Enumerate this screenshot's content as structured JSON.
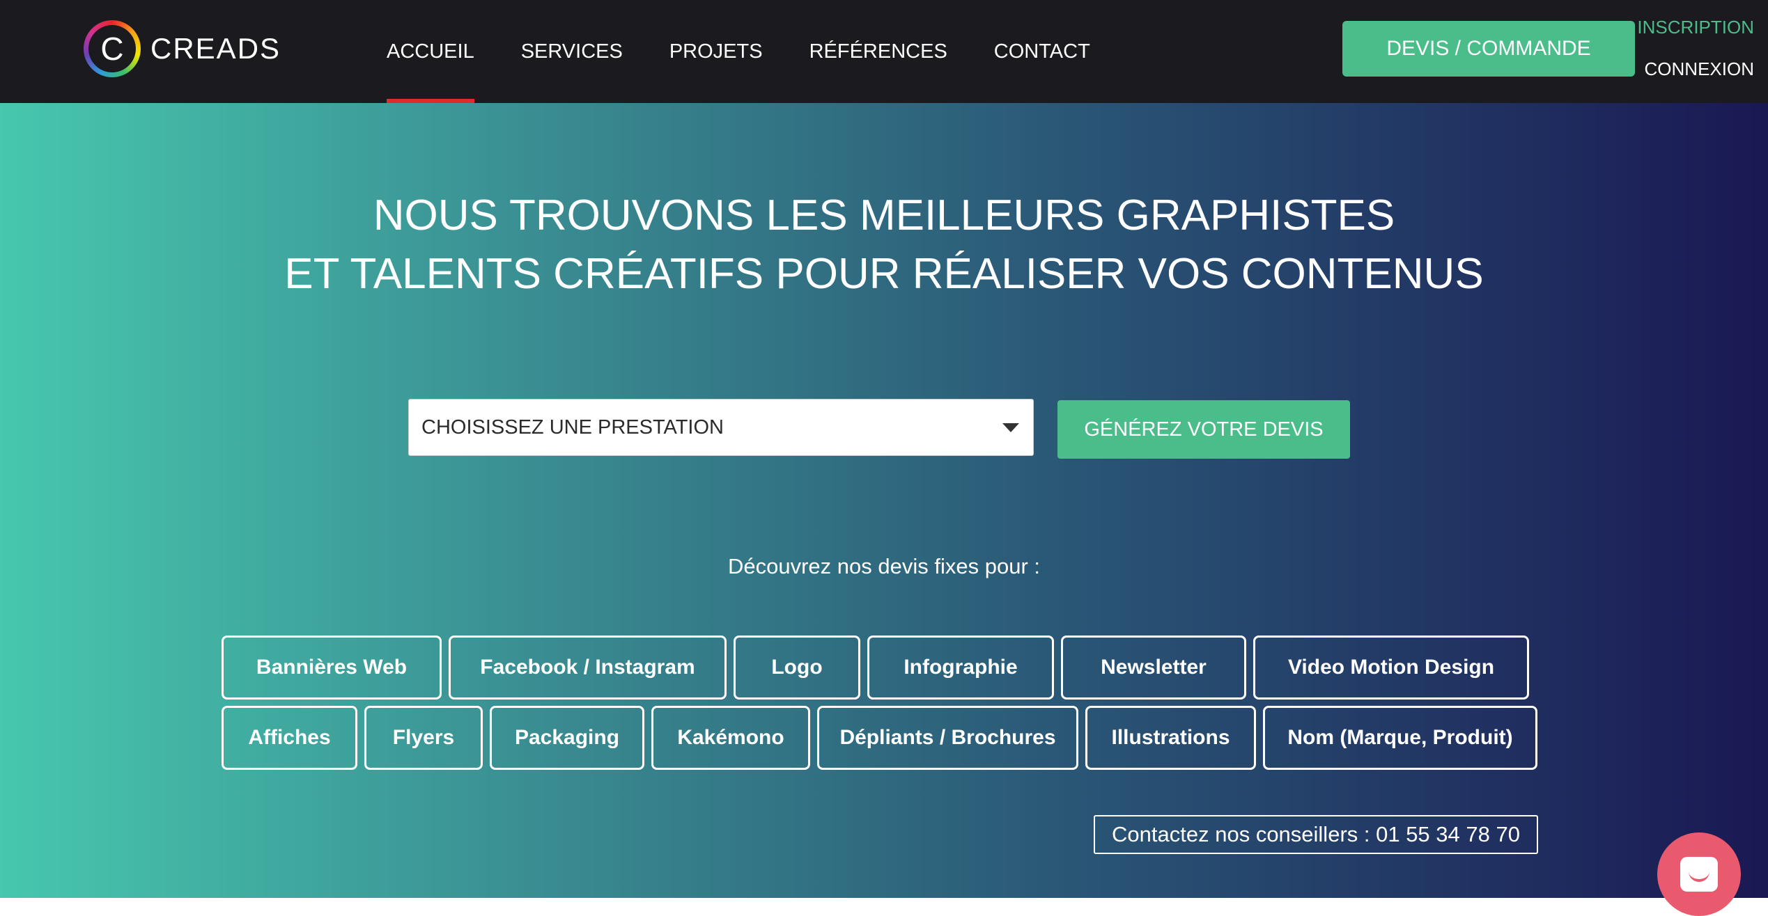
{
  "header": {
    "logo_letter": "C",
    "logo_text": "CREADS",
    "nav": [
      {
        "label": "ACCUEIL",
        "active": true
      },
      {
        "label": "SERVICES",
        "active": false
      },
      {
        "label": "PROJETS",
        "active": false
      },
      {
        "label": "RÉFÉRENCES",
        "active": false
      },
      {
        "label": "CONTACT",
        "active": false
      }
    ],
    "cta_label": "DEVIS / COMMANDE",
    "inscription_label": "INSCRIPTION",
    "connexion_label": "CONNEXION"
  },
  "hero": {
    "headline_line1": "NOUS TROUVONS LES MEILLEURS GRAPHISTES",
    "headline_line2": "ET TALENTS CRÉATIFS POUR RÉALISER VOS CONTENUS",
    "select_value": "CHOISISSEZ UNE PRESTATION",
    "generate_label": "GÉNÉREZ VOTRE DEVIS",
    "subtitle": "Découvrez nos devis fixes pour :",
    "tags_row1": [
      "Bannières Web",
      "Facebook / Instagram",
      "Logo",
      "Infographie",
      "Newsletter",
      "Video Motion Design"
    ],
    "tags_row2": [
      "Affiches",
      "Flyers",
      "Packaging",
      "Kakémono",
      "Dépliants / Brochures",
      "Illustrations",
      "Nom (Marque, Produit)"
    ],
    "phone_label": "Contactez nos conseillers : 01 55 34 78 70"
  },
  "colors": {
    "accent_green": "#4bbd8b",
    "active_underline": "#e02b2b",
    "header_bg": "#1b1b1f",
    "chat_bubble": "#ea5a6e"
  },
  "icons": {
    "logo": "creads-rainbow-ring-logo",
    "select_caret": "chevron-down-icon",
    "chat": "chat-icon"
  }
}
